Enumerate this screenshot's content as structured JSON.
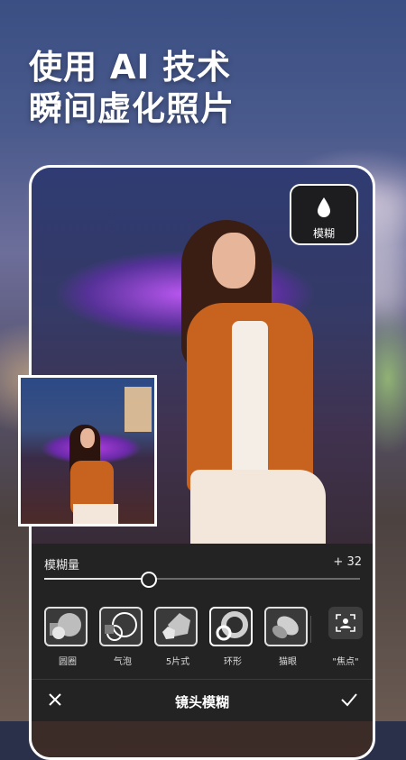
{
  "headline": {
    "line1": "使用 AI 技术",
    "line2": "瞬间虚化照片"
  },
  "chip": {
    "label": "模糊",
    "icon": "droplet-icon"
  },
  "panel": {
    "slider_label": "模糊量",
    "slider_value": "+ 32",
    "slider_fraction": 0.33,
    "shapes": [
      {
        "label": "圆圈",
        "icon": "circle-shape-icon"
      },
      {
        "label": "气泡",
        "icon": "bubble-shape-icon"
      },
      {
        "label": "5片式",
        "icon": "pentagon-shape-icon"
      },
      {
        "label": "环形",
        "icon": "ring-shape-icon"
      },
      {
        "label": "猫眼",
        "icon": "cat-eye-shape-icon"
      }
    ],
    "focus_label": "\"焦点\"",
    "title": "镜头模糊"
  },
  "colors": {
    "panel": "#232323",
    "accent": "#ffffff"
  }
}
